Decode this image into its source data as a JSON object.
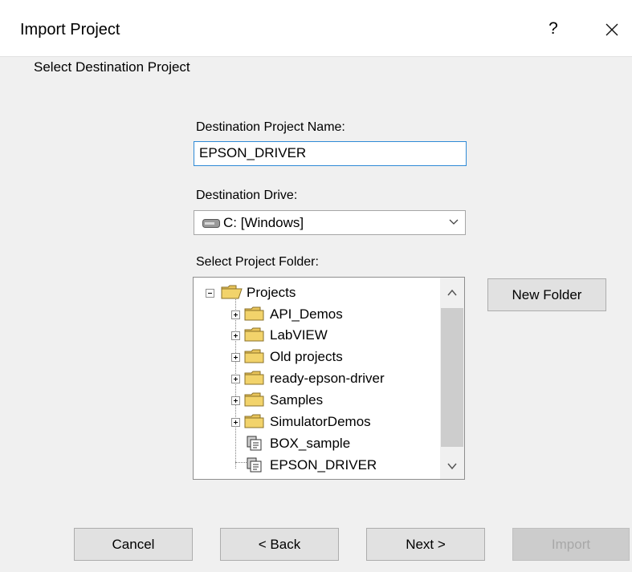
{
  "window": {
    "title": "Import Project",
    "help_label": "?",
    "close_icon": "close-icon"
  },
  "section": {
    "label": "Select Destination Project"
  },
  "project_name": {
    "label": "Destination Project Name:",
    "value": "EPSON_DRIVER"
  },
  "drive": {
    "label": "Destination Drive:",
    "value": "C: [Windows]",
    "icon": "drive-icon"
  },
  "folder": {
    "label": "Select Project Folder:",
    "root": "Projects",
    "children": [
      "API_Demos",
      "LabVIEW",
      "Old projects",
      "ready-epson-driver",
      "Samples",
      "SimulatorDemos"
    ],
    "projects": [
      "BOX_sample",
      "EPSON_DRIVER"
    ]
  },
  "buttons": {
    "new_folder": "New Folder",
    "cancel": "Cancel",
    "back": "< Back",
    "next": "Next >",
    "import": "Import"
  },
  "colors": {
    "folder": "#f2d36b",
    "focus_border": "#2f8ad6"
  }
}
